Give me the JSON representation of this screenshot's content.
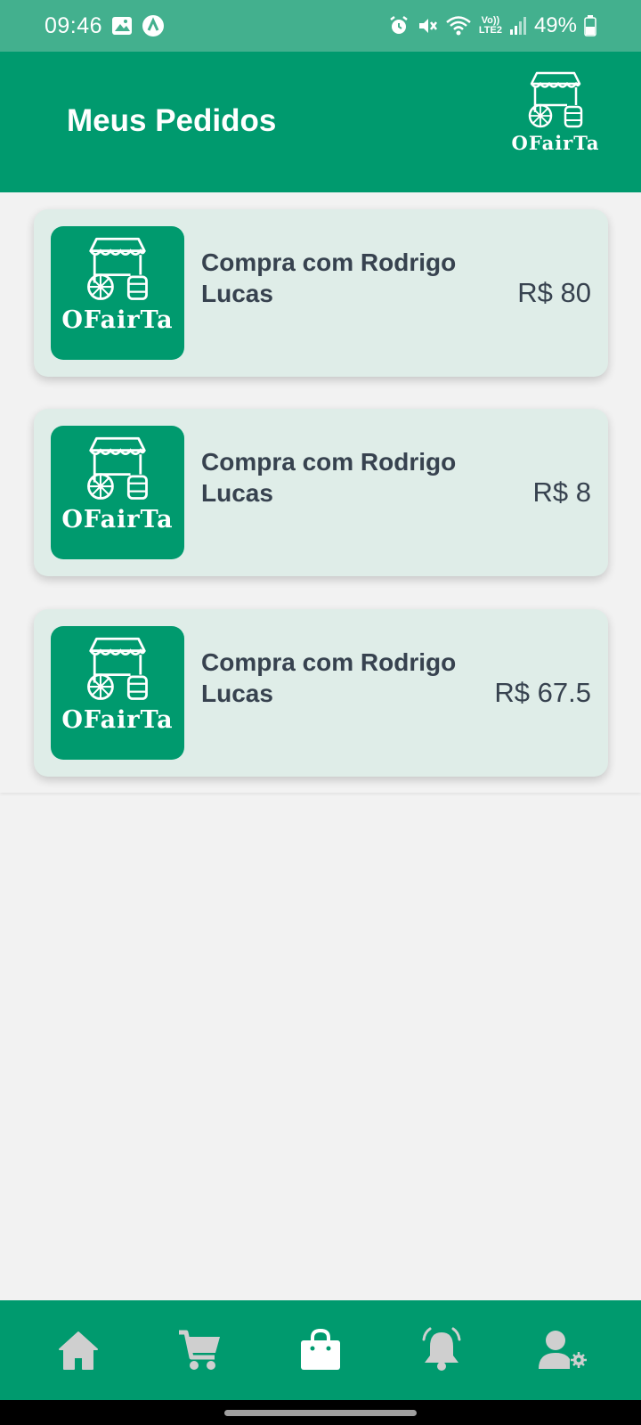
{
  "status_bar": {
    "time": "09:46",
    "battery": "49%",
    "network_label_top": "Vo))",
    "network_label_bottom": "LTE2",
    "icons": [
      "gallery-icon",
      "app-notification-icon",
      "alarm-icon",
      "mute-icon",
      "wifi-icon",
      "signal-icon",
      "battery-icon"
    ]
  },
  "header": {
    "title": "Meus Pedidos",
    "logo_text": "OFairTa"
  },
  "orders": [
    {
      "logo_text": "OFairTa",
      "title": "Compra com Rodrigo Lucas",
      "price": "R$ 80"
    },
    {
      "logo_text": "OFairTa",
      "title": "Compra com Rodrigo Lucas",
      "price": "R$ 8"
    },
    {
      "logo_text": "OFairTa",
      "title": "Compra com Rodrigo Lucas",
      "price": "R$ 67.5"
    }
  ],
  "bottom_nav": {
    "items": [
      "home-icon",
      "cart-icon",
      "shopping-bag-icon",
      "bell-icon",
      "user-settings-icon"
    ],
    "active_index": 2,
    "active_color": "#ffffff",
    "inactive_color": "#cfcfcf"
  },
  "colors": {
    "primary": "#009a6e",
    "status_bar": "#43b08e",
    "card_background": "#dfede8",
    "text_dark": "#37424f"
  }
}
